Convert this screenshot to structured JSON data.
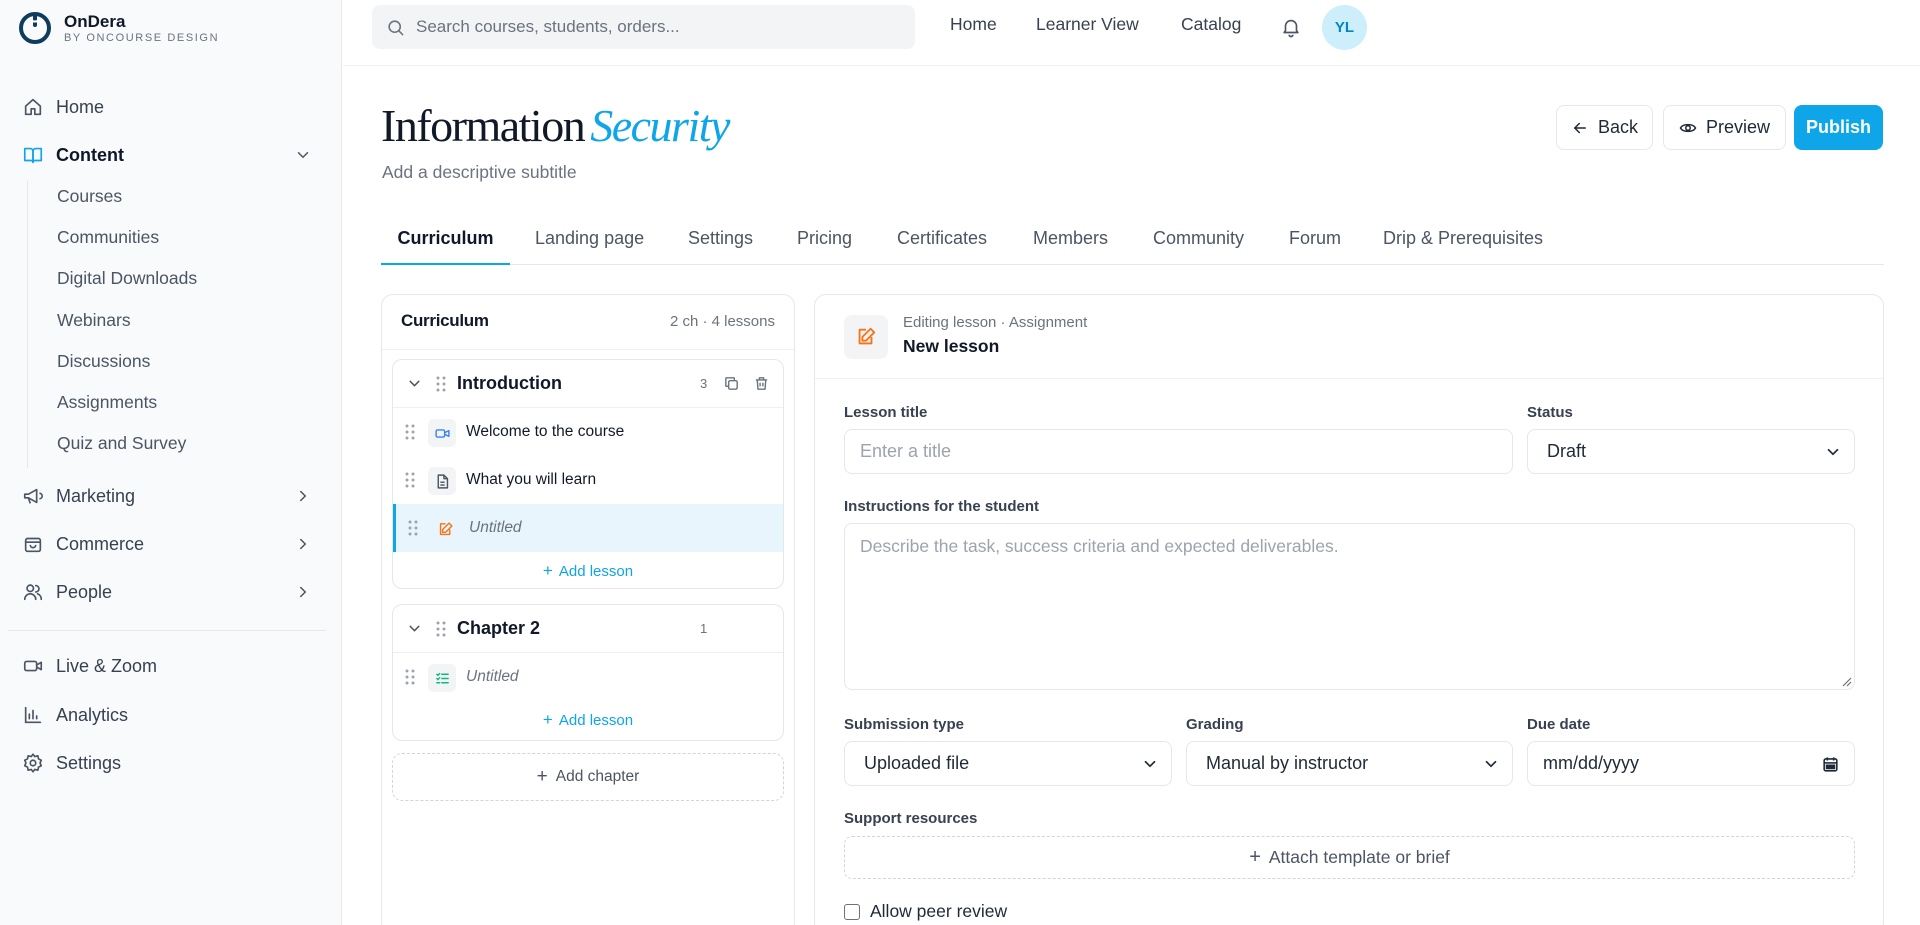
{
  "brand": {
    "name": "OnDera",
    "sub": "BY ONCOURSE DESIGN"
  },
  "sidebar": {
    "items": [
      {
        "label": "Home",
        "icon": "home-icon"
      },
      {
        "label": "Content",
        "icon": "book-open-icon",
        "expanded": true
      },
      {
        "label": "Marketing",
        "icon": "megaphone-icon"
      },
      {
        "label": "Commerce",
        "icon": "shopping-bag-icon"
      },
      {
        "label": "People",
        "icon": "users-icon"
      },
      {
        "label": "Live & Zoom",
        "icon": "video-icon"
      },
      {
        "label": "Analytics",
        "icon": "bar-chart-icon"
      },
      {
        "label": "Settings",
        "icon": "gear-icon"
      }
    ],
    "content_sub": [
      "Courses",
      "Communities",
      "Digital Downloads",
      "Webinars",
      "Discussions",
      "Assignments",
      "Quiz and Survey"
    ]
  },
  "topbar": {
    "search_placeholder": "Search courses, students, orders...",
    "links": [
      "Home",
      "Learner View",
      "Catalog"
    ],
    "avatar": "YL"
  },
  "header": {
    "title_main": "Information",
    "title_accent": "Security",
    "subtitle": "Add a descriptive subtitle",
    "back": "Back",
    "preview": "Preview",
    "publish": "Publish"
  },
  "tabs": [
    "Curriculum",
    "Landing page",
    "Settings",
    "Pricing",
    "Certificates",
    "Members",
    "Community",
    "Forum",
    "Drip & Prerequisites"
  ],
  "curriculum": {
    "title": "Curriculum",
    "count": "2 ch · 4 lessons",
    "chapters": [
      {
        "name": "Introduction",
        "count": "3",
        "lessons": [
          {
            "name": "Welcome to the course",
            "type": "video-icon"
          },
          {
            "name": "What you will learn",
            "type": "document-icon"
          },
          {
            "name": "Untitled",
            "type": "assignment-icon"
          }
        ]
      },
      {
        "name": "Chapter 2",
        "count": "1",
        "lessons": [
          {
            "name": "Untitled",
            "type": "quiz-icon"
          }
        ]
      }
    ],
    "add_lesson": "Add lesson",
    "add_chapter": "Add chapter"
  },
  "editor": {
    "kicker": "Editing lesson · Assignment",
    "name": "New lesson",
    "lesson_title_label": "Lesson title",
    "lesson_title_placeholder": "Enter a title",
    "status_label": "Status",
    "status_value": "Draft",
    "instructions_label": "Instructions for the student",
    "instructions_placeholder": "Describe the task, success criteria and expected deliverables.",
    "submission_label": "Submission type",
    "submission_value": "Uploaded file",
    "grading_label": "Grading",
    "grading_value": "Manual by instructor",
    "due_label": "Due date",
    "due_value": "mm/dd/yyyy",
    "resources_label": "Support resources",
    "attach_label": "Attach template or brief",
    "peer_label": "Allow peer review"
  },
  "colors": {
    "accent": "#0ea5e9",
    "assignment": "#f97316",
    "video": "#3b82f6",
    "quiz": "#10b981"
  }
}
